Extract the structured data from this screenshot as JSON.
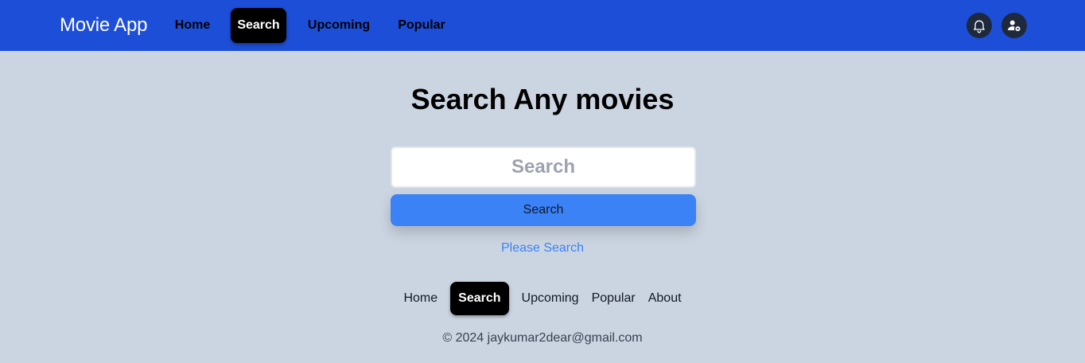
{
  "app": {
    "brand": "Movie App"
  },
  "nav": {
    "home": "Home",
    "search": "Search",
    "upcoming": "Upcoming",
    "popular": "Popular",
    "active": "Search"
  },
  "header_actions": {
    "notifications_icon": "bell-icon",
    "user_icon": "user-settings-icon"
  },
  "main": {
    "title": "Search Any movies",
    "search_placeholder": "Search",
    "search_value": "",
    "search_button": "Search",
    "status": "Please Search"
  },
  "footer": {
    "links": [
      "Home",
      "Search",
      "Upcoming",
      "Popular",
      "About"
    ],
    "active": "Search",
    "copyright": "© 2024 jaykumar2dear@gmail.com"
  },
  "colors": {
    "navbar": "#1d4ed8",
    "background": "#cbd5e1",
    "accent": "#3b82f6",
    "active_tab": "#000000"
  }
}
